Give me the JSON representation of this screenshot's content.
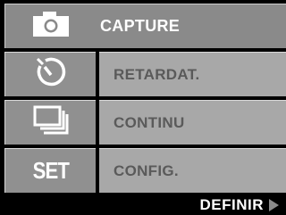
{
  "menu": {
    "items": [
      {
        "icon": "camera-icon",
        "label": "CAPTURE",
        "selected": true
      },
      {
        "icon": "self-timer-icon",
        "label": "RETARDAT.",
        "selected": false
      },
      {
        "icon": "continuous-shots-icon",
        "label": "CONTINU",
        "selected": false
      },
      {
        "icon": "set-icon",
        "icon_text": "SET",
        "label": "CONFIG.",
        "selected": false
      }
    ]
  },
  "footer": {
    "action_label": "DEFINIR",
    "arrow_icon": "right-arrow-icon"
  },
  "colors": {
    "background": "#000000",
    "selected_row": "#8a8a8a",
    "row_label_bg": "#a8a8a8",
    "icon_bg": "#909090",
    "label_text": "#5a5a5a",
    "selected_text": "#ffffff"
  }
}
